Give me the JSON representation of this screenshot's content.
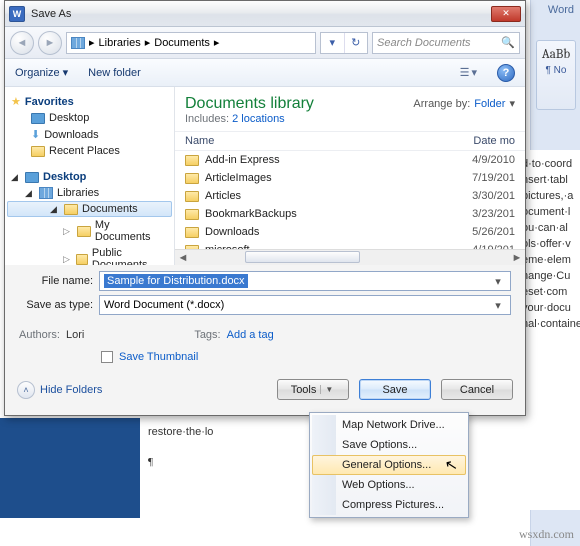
{
  "word": {
    "title": "Word",
    "ribbon_sample": "AaBb",
    "ribbon_sub": "¶ No",
    "snippets": [
      "d·to·coord",
      "nsert·tabl",
      "pictures,·a",
      "",
      "ocument·l",
      "ou·can·al",
      "ols·offer·v",
      "",
      "eme·elem",
      "hange·Cu",
      "eset·com",
      "your·docu",
      "nal·contained·in·your·cu"
    ],
    "body_line": "restore·the·lo",
    "para": "¶"
  },
  "dialog": {
    "title": "Save As",
    "breadcrumb": [
      "Libraries",
      "Documents"
    ],
    "search_placeholder": "Search Documents",
    "toolbar": {
      "organize": "Organize",
      "newfolder": "New folder"
    },
    "library": {
      "title": "Documents library",
      "includes_label": "Includes:",
      "locations": "2 locations",
      "arrange_label": "Arrange by:",
      "arrange_value": "Folder"
    },
    "columns": {
      "name": "Name",
      "date": "Date mo"
    },
    "files": [
      {
        "name": "Add-in Express",
        "date": "4/9/2010"
      },
      {
        "name": "ArticleImages",
        "date": "7/19/201"
      },
      {
        "name": "Articles",
        "date": "3/30/201"
      },
      {
        "name": "BookmarkBackups",
        "date": "3/23/201"
      },
      {
        "name": "Downloads",
        "date": "5/26/201"
      },
      {
        "name": "microsoft",
        "date": "4/19/201"
      }
    ],
    "nav": {
      "favorites": "Favorites",
      "desktop": "Desktop",
      "downloads": "Downloads",
      "recent": "Recent Places",
      "desktop2": "Desktop",
      "libraries": "Libraries",
      "documents": "Documents",
      "mydocs": "My Documents",
      "pubdocs": "Public Documents"
    },
    "form": {
      "filename_label": "File name:",
      "filename_value": "Sample for Distribution.docx",
      "type_label": "Save as type:",
      "type_value": "Word Document (*.docx)",
      "authors_label": "Authors:",
      "authors_value": "Lori",
      "tags_label": "Tags:",
      "tags_value": "Add a tag",
      "save_thumb": "Save Thumbnail"
    },
    "buttons": {
      "hide": "Hide Folders",
      "tools": "Tools",
      "save": "Save",
      "cancel": "Cancel"
    },
    "tools_menu": [
      "Map Network Drive...",
      "Save Options...",
      "General Options...",
      "Web Options...",
      "Compress Pictures..."
    ]
  },
  "watermark": "wsxdn.com"
}
